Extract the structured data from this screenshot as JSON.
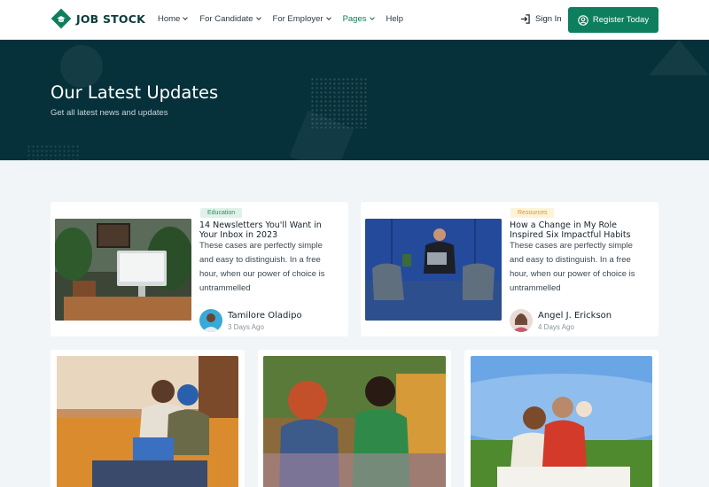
{
  "brand": {
    "name": "JOB STOCK",
    "accent": "#0e7f5e",
    "dark": "#06303a"
  },
  "nav": {
    "items": [
      {
        "label": "Home",
        "dropdown": true,
        "active": false
      },
      {
        "label": "For Candidate",
        "dropdown": true,
        "active": false
      },
      {
        "label": "For Employer",
        "dropdown": true,
        "active": false
      },
      {
        "label": "Pages",
        "dropdown": true,
        "active": true
      },
      {
        "label": "Help",
        "dropdown": false,
        "active": false
      }
    ],
    "signin_label": "Sign In",
    "register_label": "Register Today"
  },
  "hero": {
    "title": "Our Latest Updates",
    "subtitle": "Get all latest news and updates"
  },
  "posts": [
    {
      "tag": "Education",
      "title": "14 Newsletters You'll Want in Your Inbox in 2023",
      "description": "These cases are perfectly simple and easy to distinguish. In a free hour, when our power of choice is untrammelled",
      "author": "Tamilore Oladipo",
      "time": "3 Days Ago"
    },
    {
      "tag": "Resources",
      "title": "How a Change in My Role Inspired Six Impactful Habits",
      "description": "These cases are perfectly simple and easy to distinguish. In a free hour, when our power of choice is untrammelled",
      "author": "Angel J. Erickson",
      "time": "4 Days Ago"
    }
  ],
  "gallery": [
    {
      "icon": "photo-friends-laptop-icon"
    },
    {
      "icon": "photo-women-talking-icon"
    },
    {
      "icon": "photo-family-picnic-icon"
    }
  ]
}
